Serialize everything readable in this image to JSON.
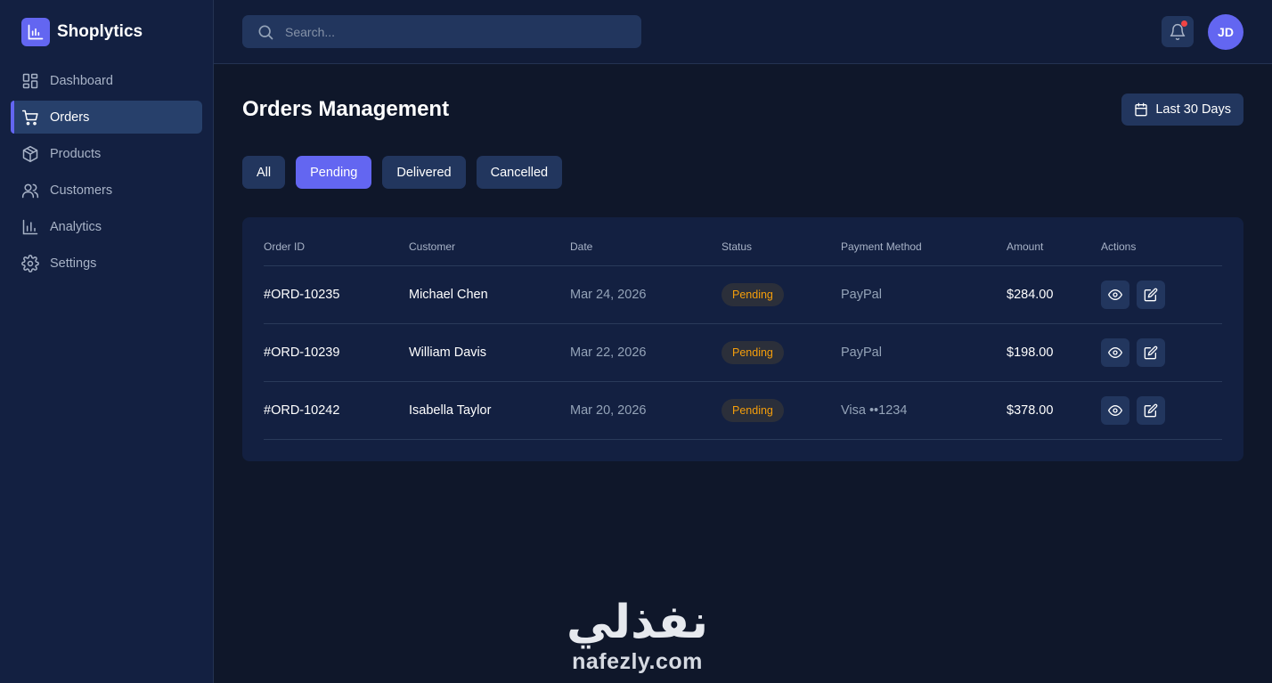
{
  "brand": {
    "name": "Shoplytics",
    "logo_icon": "bar-chart-icon",
    "accent": "#6366f1"
  },
  "sidebar": {
    "items": [
      {
        "label": "Dashboard",
        "icon": "dashboard-icon",
        "active": false
      },
      {
        "label": "Orders",
        "icon": "cart-icon",
        "active": true
      },
      {
        "label": "Products",
        "icon": "box-icon",
        "active": false
      },
      {
        "label": "Customers",
        "icon": "users-icon",
        "active": false
      },
      {
        "label": "Analytics",
        "icon": "analytics-icon",
        "active": false
      },
      {
        "label": "Settings",
        "icon": "gear-icon",
        "active": false
      }
    ]
  },
  "topbar": {
    "search_placeholder": "Search...",
    "notification_badge_color": "#ef4444",
    "avatar_initials": "JD"
  },
  "page": {
    "title": "Orders Management",
    "date_range_label": "Last 30 Days"
  },
  "filters": [
    {
      "label": "All",
      "active": false
    },
    {
      "label": "Pending",
      "active": true
    },
    {
      "label": "Delivered",
      "active": false
    },
    {
      "label": "Cancelled",
      "active": false
    }
  ],
  "table": {
    "headers": [
      "Order ID",
      "Customer",
      "Date",
      "Status",
      "Payment Method",
      "Amount",
      "Actions"
    ],
    "rows": [
      {
        "order_id": "#ORD-10235",
        "customer": "Michael Chen",
        "date": "Mar 24, 2026",
        "status": "Pending",
        "payment": "PayPal",
        "amount": "$284.00"
      },
      {
        "order_id": "#ORD-10239",
        "customer": "William Davis",
        "date": "Mar 22, 2026",
        "status": "Pending",
        "payment": "PayPal",
        "amount": "$198.00"
      },
      {
        "order_id": "#ORD-10242",
        "customer": "Isabella Taylor",
        "date": "Mar 20, 2026",
        "status": "Pending",
        "payment": "Visa ••1234",
        "amount": "$378.00"
      }
    ],
    "status_color": "#f59e0b"
  },
  "watermark": {
    "arabic": "نفذلي",
    "latin": "nafezly.com"
  }
}
